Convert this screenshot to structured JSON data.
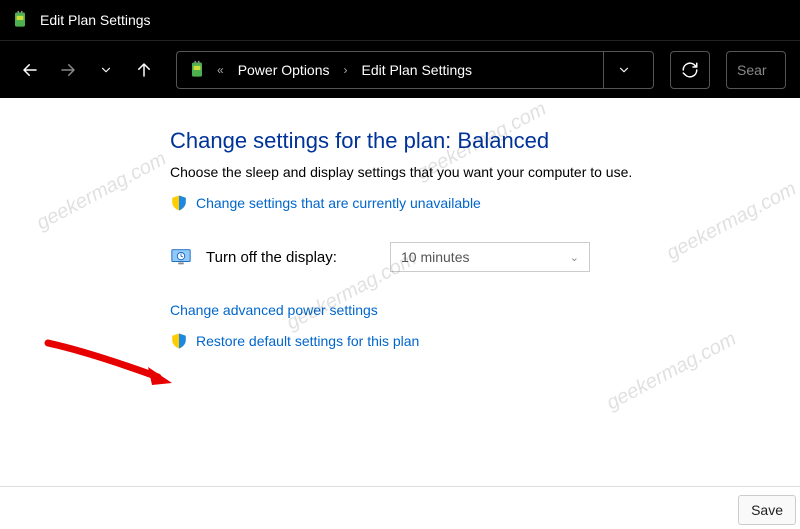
{
  "titlebar": {
    "title": "Edit Plan Settings"
  },
  "breadcrumb": {
    "item1": "Power Options",
    "item2": "Edit Plan Settings"
  },
  "search": {
    "placeholder": "Sear"
  },
  "main": {
    "heading": "Change settings for the plan: Balanced",
    "subtext": "Choose the sleep and display settings that you want your computer to use.",
    "uac_link": "Change settings that are currently unavailable",
    "display_off_label": "Turn off the display:",
    "display_off_value": "10 minutes",
    "advanced_link": "Change advanced power settings",
    "restore_link": "Restore default settings for this plan"
  },
  "footer": {
    "save_label": "Save"
  },
  "watermark": "geekermag.com"
}
